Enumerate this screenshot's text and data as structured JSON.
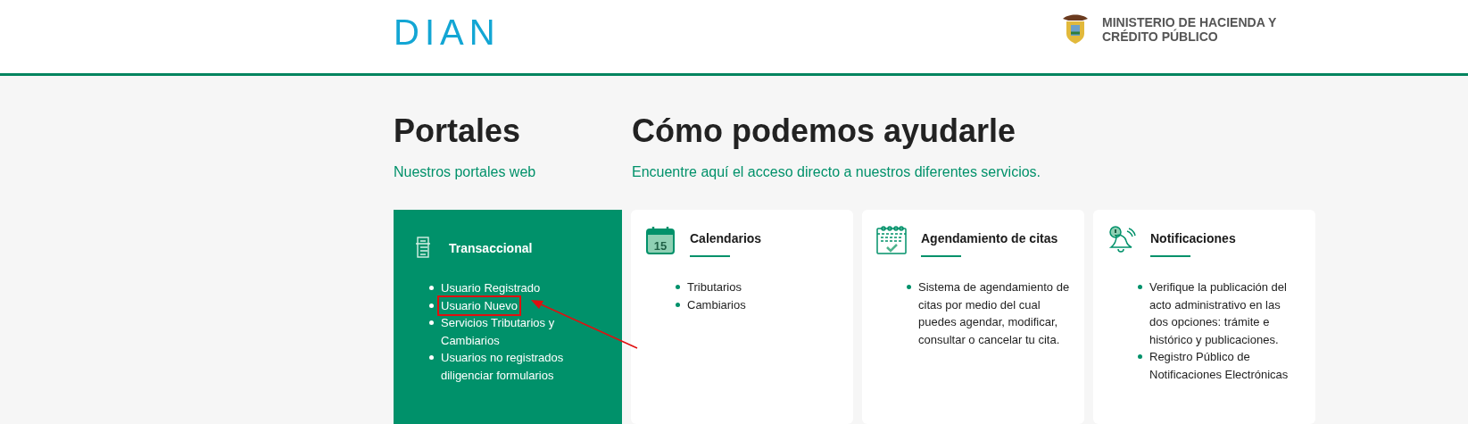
{
  "header": {
    "logo": "DIAN",
    "ministry": "MINISTERIO DE HACIENDA Y CRÉDITO PÚBLICO"
  },
  "portals": {
    "title": "Portales",
    "subtitle": "Nuestros portales web"
  },
  "help": {
    "title": "Cómo podemos ayudarle",
    "subtitle": "Encuentre aquí el acceso directo a nuestros diferentes servicios."
  },
  "cards": [
    {
      "kind": "transactional",
      "title": "Transaccional",
      "items": [
        {
          "text": "Usuario Registrado",
          "highlighted": false
        },
        {
          "text": "Usuario Nuevo",
          "highlighted": true
        },
        {
          "text": "Servicios Tributarios y Cambiarios",
          "highlighted": false
        },
        {
          "text": "Usuarios no registrados diligenciar formularios",
          "highlighted": false
        }
      ]
    },
    {
      "kind": "calendar",
      "title": "Calendarios",
      "icon_text": "15",
      "items": [
        {
          "text": "Tributarios",
          "highlighted": false
        },
        {
          "text": "Cambiarios",
          "highlighted": false
        }
      ]
    },
    {
      "kind": "appointments",
      "title": "Agendamiento de citas",
      "items": [
        {
          "text": "Sistema de agendamiento de citas por medio del cual puedes agendar, modificar, consultar o cancelar tu cita.",
          "highlighted": false
        }
      ]
    },
    {
      "kind": "notifications",
      "title": "Notificaciones",
      "items": [
        {
          "text": "Verifique la publicación del acto administrativo en las dos opciones: trámite e histórico y publicaciones.",
          "highlighted": false
        },
        {
          "text": "Registro Público de Notificaciones Electrónicas",
          "highlighted": false
        }
      ]
    }
  ]
}
